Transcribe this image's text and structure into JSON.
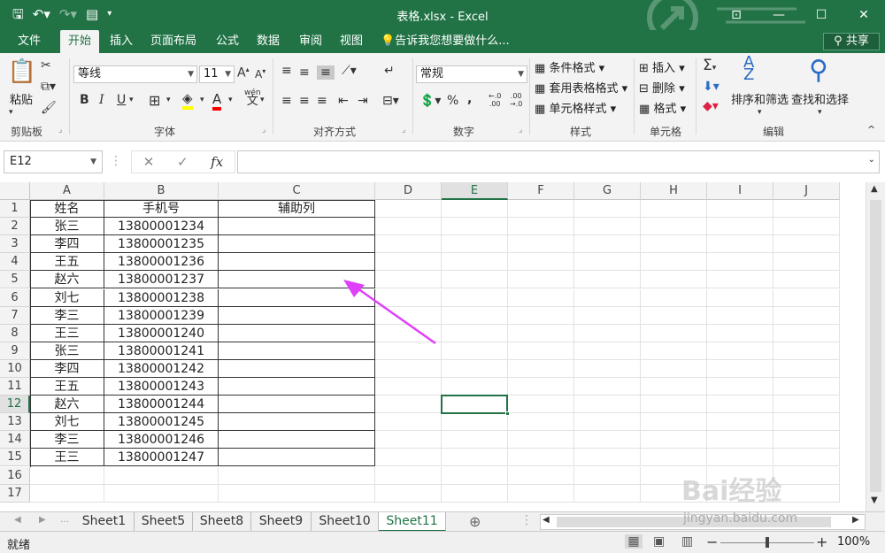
{
  "titlebar": {
    "title": "表格.xlsx - Excel",
    "save_icon": "save-icon",
    "undo_icon": "undo-icon",
    "redo_icon": "redo-icon",
    "form_icon": "form-icon"
  },
  "tabs": [
    "文件",
    "开始",
    "插入",
    "页面布局",
    "公式",
    "数据",
    "审阅",
    "视图"
  ],
  "tell_me": "告诉我您想要做什么...",
  "share": "共享",
  "ribbon": {
    "paste": "粘贴",
    "clipboard": "剪贴板",
    "font_name": "等线",
    "font_size": "11",
    "font": "字体",
    "alignment": "对齐方式",
    "number_format": "常规",
    "number": "数字",
    "cond_format": "条件格式",
    "table_format": "套用表格格式",
    "cell_style": "单元格样式",
    "styles": "样式",
    "insert": "插入",
    "delete": "删除",
    "format": "格式",
    "cells": "单元格",
    "sort_filter": "排序和筛选",
    "find_select": "查找和选择",
    "editing": "编辑",
    "bold": "B",
    "italic": "I",
    "underline": "U",
    "fx": "fx",
    "percent": "%",
    "comma": ",",
    "sigma": "Σ",
    "wen": "wén"
  },
  "namebox": "E12",
  "columns": [
    "A",
    "B",
    "C",
    "D",
    "E",
    "F",
    "G",
    "H",
    "I",
    "J"
  ],
  "rows": [
    "1",
    "2",
    "3",
    "4",
    "5",
    "6",
    "7",
    "8",
    "9",
    "10",
    "11",
    "12",
    "13",
    "14",
    "15",
    "16",
    "17"
  ],
  "table": {
    "header": [
      "姓名",
      "手机号",
      "辅助列"
    ],
    "rows": [
      [
        "张三",
        "13800001234"
      ],
      [
        "李四",
        "13800001235"
      ],
      [
        "王五",
        "13800001236"
      ],
      [
        "赵六",
        "13800001237"
      ],
      [
        "刘七",
        "13800001238"
      ],
      [
        "李三",
        "13800001239"
      ],
      [
        "王三",
        "13800001240"
      ],
      [
        "张三",
        "13800001241"
      ],
      [
        "李四",
        "13800001242"
      ],
      [
        "王五",
        "13800001243"
      ],
      [
        "赵六",
        "13800001244"
      ],
      [
        "刘七",
        "13800001245"
      ],
      [
        "李三",
        "13800001246"
      ],
      [
        "王三",
        "13800001247"
      ]
    ]
  },
  "sheets": [
    "Sheet1",
    "Sheet5",
    "Sheet8",
    "Sheet9",
    "Sheet10",
    "Sheet11"
  ],
  "active_sheet": "Sheet11",
  "status": "就绪",
  "zoom": "100%",
  "watermark": "Bai经验",
  "watermark_url": "jingyan.baidu.com",
  "accent": "#217346",
  "arrow_color": "#e040fb"
}
